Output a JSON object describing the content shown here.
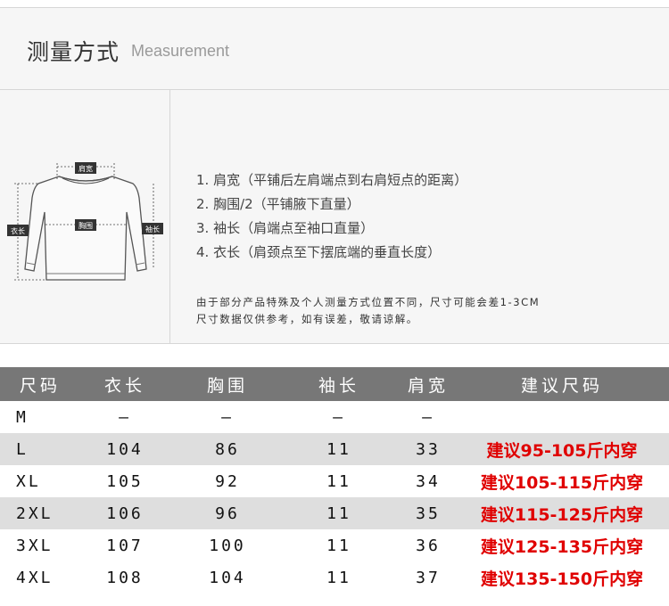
{
  "header": {
    "title_cn": "测量方式",
    "title_en": "Measurement"
  },
  "diagram": {
    "labels": {
      "shoulder": "肩宽",
      "chest": "胸围",
      "length": "衣长",
      "sleeve": "袖长"
    }
  },
  "steps": [
    "1. 肩宽（平铺后左肩端点到右肩短点的距离）",
    "2. 胸围/2（平铺腋下直量）",
    "3. 袖长（肩端点至袖口直量）",
    "4. 衣长（肩颈点至下摆底端的垂直长度）"
  ],
  "note": [
    "由于部分产品特殊及个人测量方式位置不同，尺寸可能会差1-3CM",
    "尺寸数据仅供参考，如有误差，敬请谅解。"
  ],
  "table": {
    "headers": [
      "尺码",
      "衣长",
      "胸围",
      "袖长",
      "肩宽",
      "建议尺码"
    ],
    "rows": [
      [
        "M",
        "–",
        "–",
        "–",
        "–",
        ""
      ],
      [
        "L",
        "104",
        "86",
        "11",
        "33",
        "建议95-105斤内穿"
      ],
      [
        "XL",
        "105",
        "92",
        "11",
        "34",
        "建议105-115斤内穿"
      ],
      [
        "2XL",
        "106",
        "96",
        "11",
        "35",
        "建议115-125斤内穿"
      ],
      [
        "3XL",
        "107",
        "100",
        "11",
        "36",
        "建议125-135斤内穿"
      ],
      [
        "4XL",
        "108",
        "104",
        "11",
        "37",
        "建议135-150斤内穿"
      ]
    ]
  },
  "colors": {
    "header_bg": "#777777",
    "stripe_bg": "#dedede",
    "recommend_text": "#e00000"
  }
}
